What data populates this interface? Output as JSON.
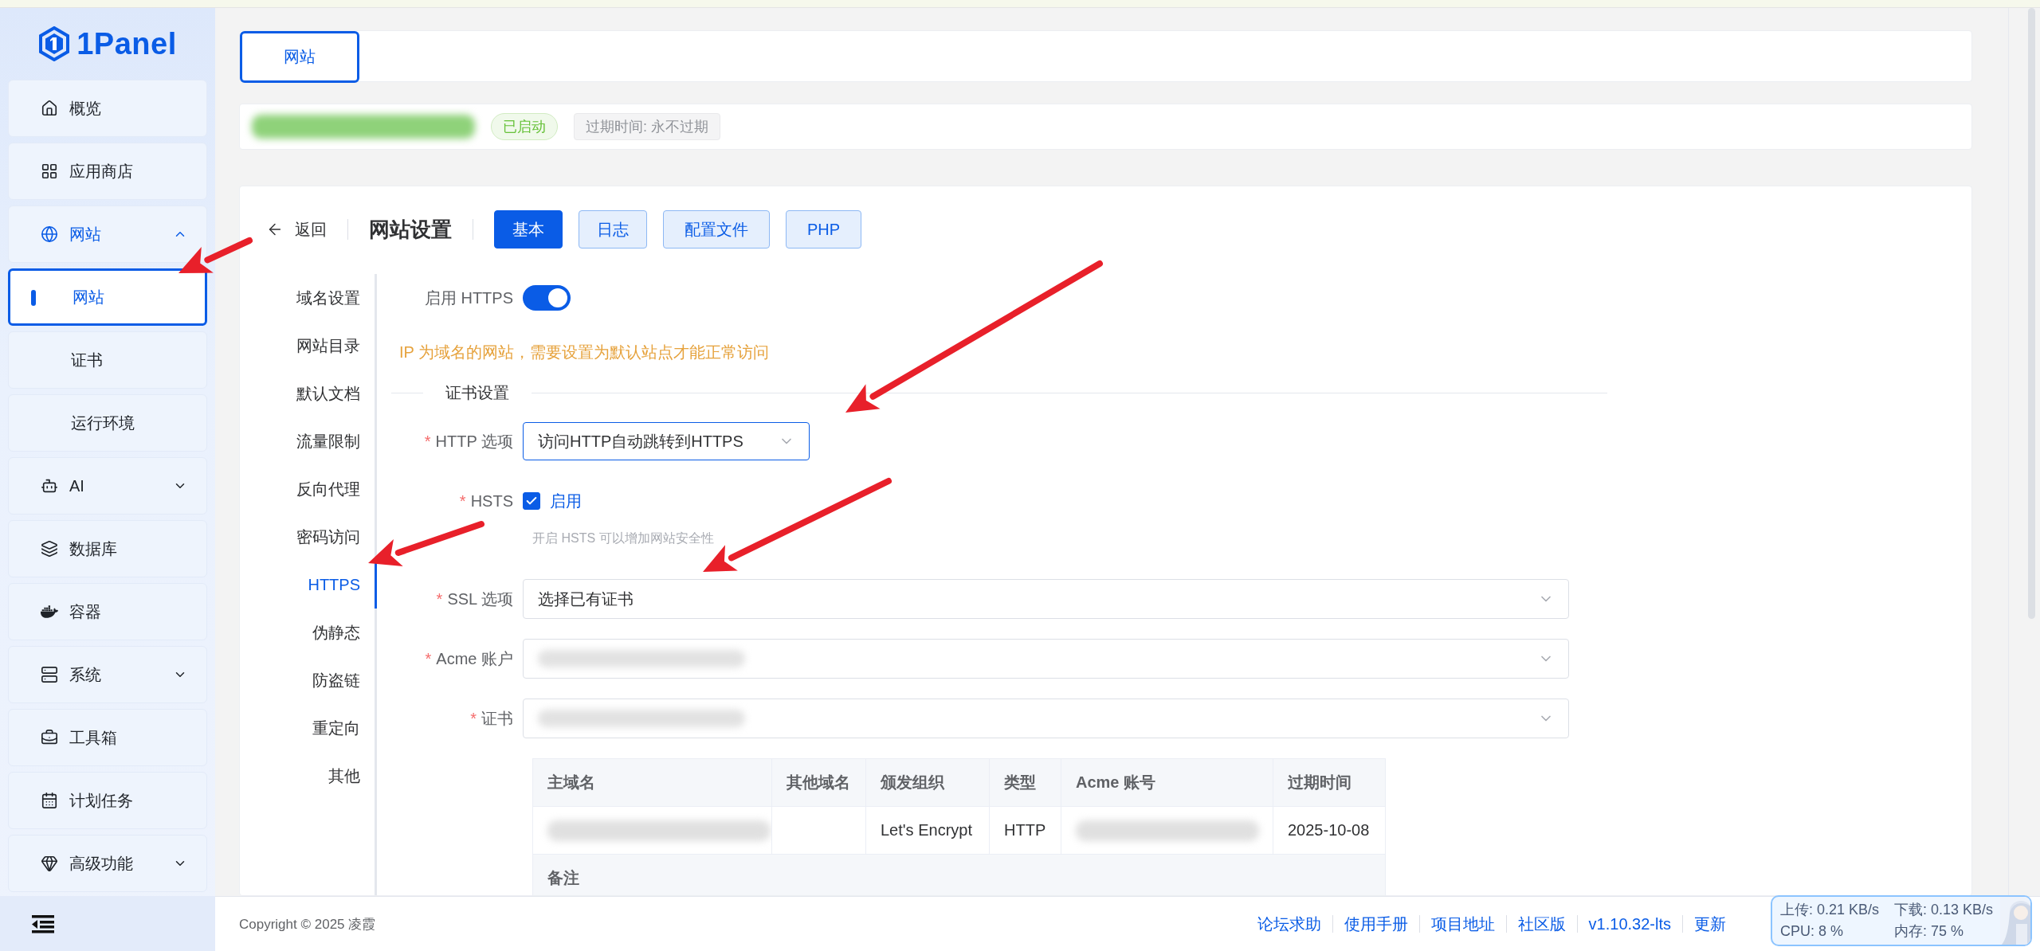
{
  "sidebar": {
    "logo": "1Panel",
    "items": [
      {
        "label": "概览",
        "selected": false
      },
      {
        "label": "应用商店",
        "selected": false
      },
      {
        "label": "网站",
        "selected": true,
        "expanded": true,
        "children": [
          {
            "label": "网站",
            "selected": true
          },
          {
            "label": "证书",
            "selected": false
          },
          {
            "label": "运行环境",
            "selected": false
          }
        ]
      },
      {
        "label": "AI",
        "selected": false,
        "expanded": false
      },
      {
        "label": "数据库",
        "selected": false
      },
      {
        "label": "容器",
        "selected": false
      },
      {
        "label": "系统",
        "selected": false,
        "expanded": false
      },
      {
        "label": "工具箱",
        "selected": false
      },
      {
        "label": "计划任务",
        "selected": false
      },
      {
        "label": "高级功能",
        "selected": false,
        "expanded": false
      }
    ]
  },
  "tabs": [
    {
      "label": "网站",
      "selected": true
    }
  ],
  "site": {
    "status": "已启动",
    "expiry": "过期时间: 永不过期"
  },
  "header": {
    "back": "返回",
    "title": "网站设置",
    "buttons": [
      {
        "label": "基本",
        "selected": true
      },
      {
        "label": "日志",
        "selected": false
      },
      {
        "label": "配置文件",
        "selected": false
      },
      {
        "label": "PHP",
        "selected": false
      }
    ]
  },
  "settings_nav": [
    {
      "label": "域名设置",
      "selected": false
    },
    {
      "label": "网站目录",
      "selected": false
    },
    {
      "label": "默认文档",
      "selected": false
    },
    {
      "label": "流量限制",
      "selected": false
    },
    {
      "label": "反向代理",
      "selected": false
    },
    {
      "label": "密码访问",
      "selected": false
    },
    {
      "label": "HTTPS",
      "selected": true
    },
    {
      "label": "伪静态",
      "selected": false
    },
    {
      "label": "防盗链",
      "selected": false
    },
    {
      "label": "重定向",
      "selected": false
    },
    {
      "label": "其他",
      "selected": false
    }
  ],
  "form": {
    "https": {
      "label": "启用 HTTPS",
      "on": true
    },
    "warning": "IP 为域名的网站，需要设置为默认站点才能正常访问",
    "section": "证书设置",
    "fields": [
      {
        "kind": "compact-select",
        "label": "HTTP 选项",
        "marker": "*",
        "focused": true,
        "value": "访问HTTP自动跳转到HTTPS"
      },
      {
        "kind": "checkbox",
        "label": "HSTS",
        "marker": "*",
        "checked": true,
        "option": "启用",
        "hint": "开启 HSTS 可以增加网站安全性"
      },
      {
        "kind": "select",
        "label": "SSL 选项",
        "marker": "*",
        "focused": false,
        "value": "选择已有证书"
      },
      {
        "kind": "select",
        "label": "Acme 账户",
        "marker": "*",
        "focused": false,
        "redacted": true
      },
      {
        "kind": "select",
        "label": "证书",
        "marker": "*",
        "focused": false,
        "redacted": true
      }
    ]
  },
  "table": {
    "columns": [
      "主域名",
      "其他域名",
      "颁发组织",
      "类型",
      "Acme 账号",
      "过期时间"
    ],
    "rows": [
      {
        "cells": [
          {
            "redacted": true
          },
          {},
          {
            "text": "Let's Encrypt"
          },
          {
            "text": "HTTP"
          },
          {
            "redacted": true
          },
          {
            "text": "2025-10-08"
          }
        ]
      }
    ],
    "remark_label": "备注"
  },
  "footer": {
    "copyright": "Copyright © 2025 凌霞",
    "links": [
      "论坛求助",
      "使用手册",
      "项目地址",
      "社区版",
      "v1.10.32-lts",
      "更新"
    ]
  },
  "monitor": {
    "upload": "上传: 0.21 KB/s",
    "download": "下载: 0.13 KB/s",
    "cpu": "CPU: 8 %",
    "memory": "内存: 75 %"
  }
}
